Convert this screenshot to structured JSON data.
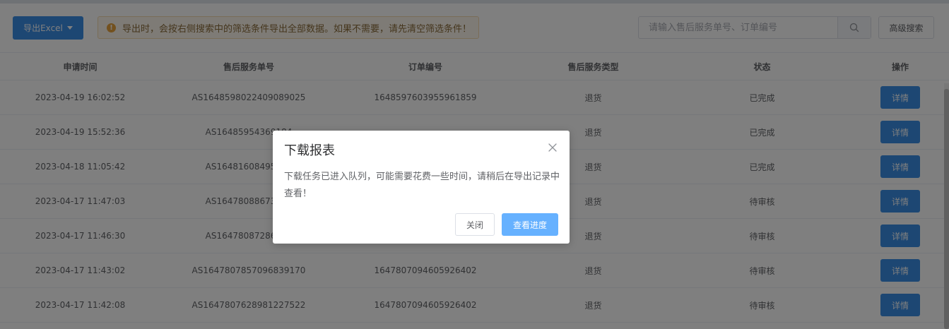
{
  "toolbar": {
    "export_label": "导出Excel",
    "notice_text": "导出时，会按右侧搜索中的筛选条件导出全部数据。如果不需要，请先清空筛选条件！",
    "search_placeholder": "请输入售后服务单号、订单编号",
    "advanced_search_label": "高级搜索"
  },
  "table": {
    "columns": [
      "申请时间",
      "售后服务单号",
      "订单编号",
      "售后服务类型",
      "状态",
      "操作"
    ],
    "rows": [
      {
        "time": "2023-04-19 16:02:52",
        "service_no": "AS1648598022409089025",
        "order_no": "1648597603955961859",
        "type": "退货",
        "status": "已完成",
        "action": "详情"
      },
      {
        "time": "2023-04-19 15:52:36",
        "service_no": "AS16485954369184",
        "order_no": "",
        "type": "退货",
        "status": "已完成",
        "action": "详情"
      },
      {
        "time": "2023-04-18 11:05:42",
        "service_no": "AS16481608495369",
        "order_no": "",
        "type": "退货",
        "status": "已完成",
        "action": "详情"
      },
      {
        "time": "2023-04-17 11:47:03",
        "service_no": "AS16478088673075",
        "order_no": "",
        "type": "退货",
        "status": "待审核",
        "action": "详情"
      },
      {
        "time": "2023-04-17 11:46:30",
        "service_no": "AS16478087286815",
        "order_no": "",
        "type": "退货",
        "status": "待审核",
        "action": "详情"
      },
      {
        "time": "2023-04-17 11:43:02",
        "service_no": "AS1647807857096839170",
        "order_no": "1647807094605926402",
        "type": "退货",
        "status": "待审核",
        "action": "详情"
      },
      {
        "time": "2023-04-17 11:42:08",
        "service_no": "AS1647807628981227522",
        "order_no": "1647807094605926402",
        "type": "退货",
        "status": "待审核",
        "action": "详情"
      }
    ]
  },
  "dialog": {
    "title": "下载报表",
    "message": "下载任务已进入队列，可能需要花费一些时间，请稍后在导出记录中查看！",
    "cancel_label": "关闭",
    "confirm_label": "查看进度"
  },
  "colors": {
    "primary": "#3a8ee6",
    "primary_light": "#66b1ff",
    "warning": "#e6a23c"
  },
  "icons": {
    "export_caret": "caret-down-icon",
    "notice": "warning-icon",
    "search": "search-icon",
    "dialog_close": "close-icon"
  }
}
